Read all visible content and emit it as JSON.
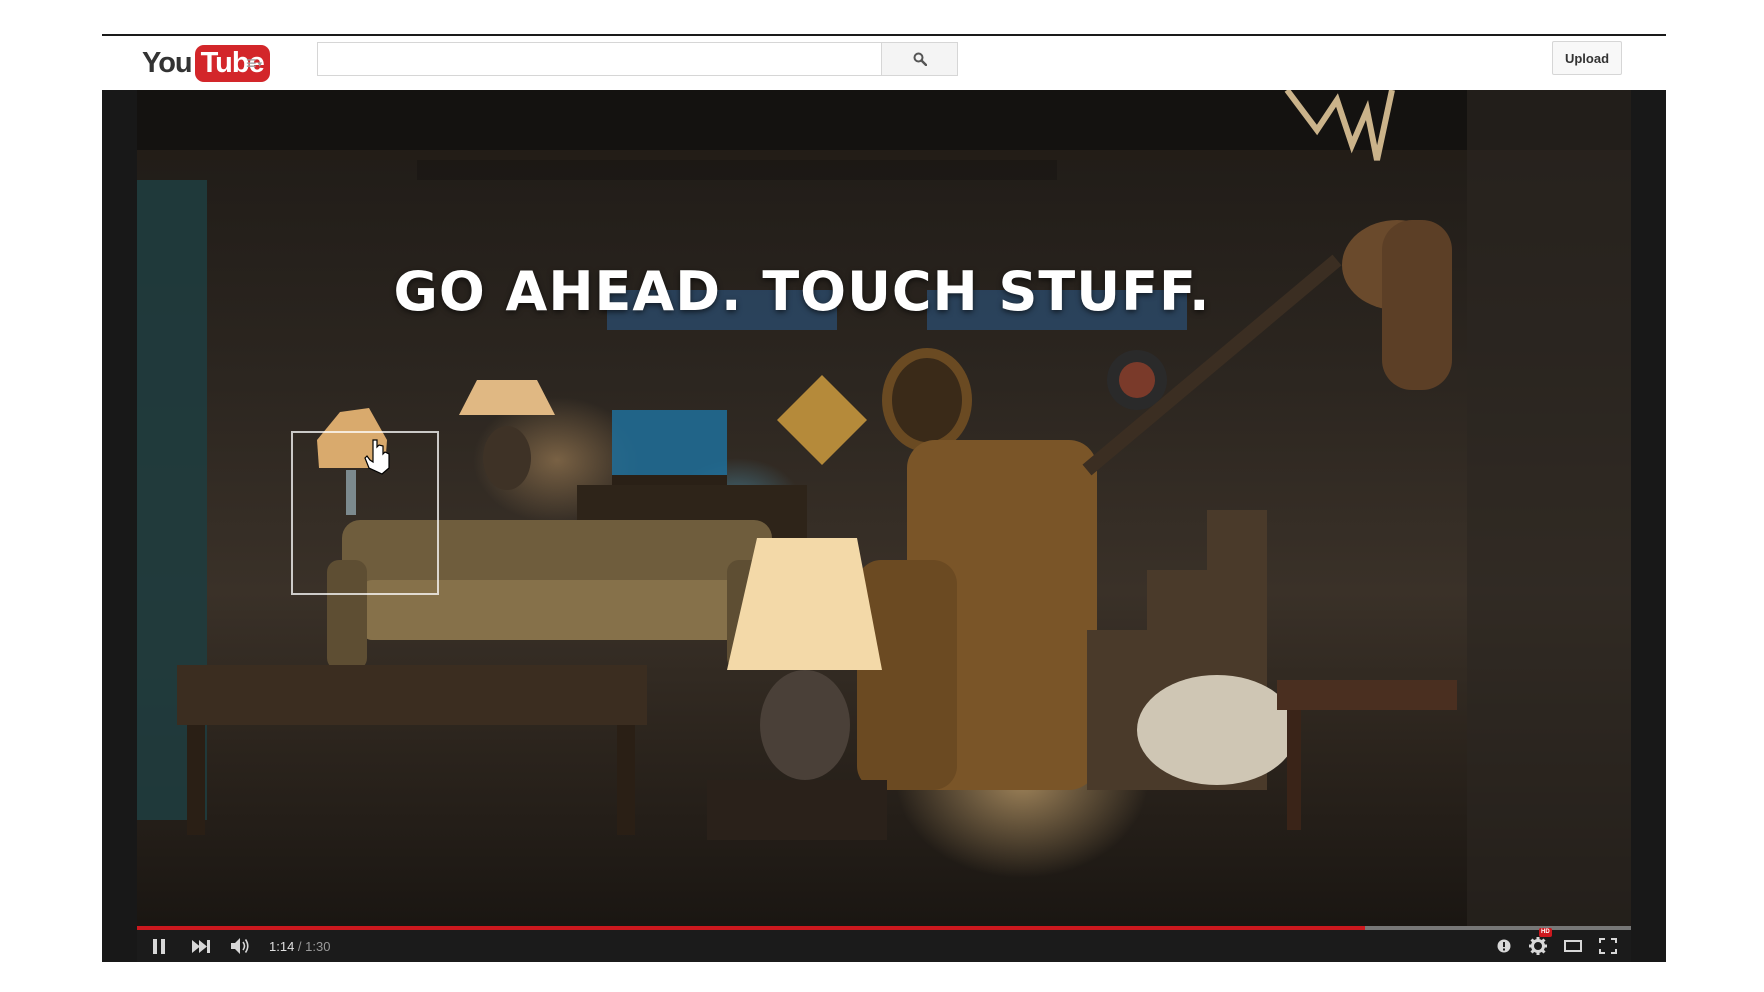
{
  "header": {
    "logo_you": "You",
    "logo_tube": "Tube",
    "guide_icon": "hamburger-menu-icon",
    "search_placeholder": "",
    "search_value": "",
    "upload_label": "Upload"
  },
  "video": {
    "headline": "GO AHEAD. TOUCH STUFF."
  },
  "controls": {
    "current_time": "1:14",
    "separator": " / ",
    "duration": "1:30",
    "progress_fraction": 0.822
  },
  "colors": {
    "brand_red": "#cc181e",
    "logo_red": "#d3262a",
    "player_bg": "#181818"
  }
}
